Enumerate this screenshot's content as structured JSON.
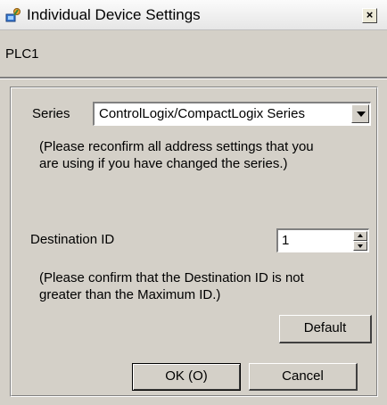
{
  "window": {
    "title": "Individual Device Settings",
    "icon": "device-settings-icon",
    "close_label": "×"
  },
  "device": {
    "name": "PLC1"
  },
  "series": {
    "label": "Series",
    "value": "ControlLogix/CompactLogix Series",
    "note_line1": "(Please reconfirm all address settings that you",
    "note_line2": "are using if you have changed the series.)"
  },
  "destination": {
    "label": "Destination ID",
    "value": "1",
    "note_line1": "(Please confirm that the Destination ID is not",
    "note_line2": "greater than the Maximum ID.)"
  },
  "buttons": {
    "default_label": "Default",
    "ok_label": "OK (O)",
    "cancel_label": "Cancel"
  }
}
